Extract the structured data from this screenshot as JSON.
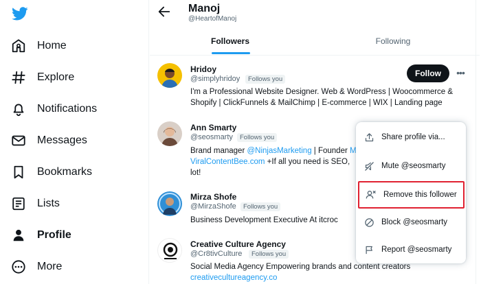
{
  "sidebar": {
    "items": [
      {
        "label": "Home",
        "icon": "home-icon"
      },
      {
        "label": "Explore",
        "icon": "hashtag-icon"
      },
      {
        "label": "Notifications",
        "icon": "bell-icon"
      },
      {
        "label": "Messages",
        "icon": "envelope-icon"
      },
      {
        "label": "Bookmarks",
        "icon": "bookmark-icon"
      },
      {
        "label": "Lists",
        "icon": "list-icon"
      },
      {
        "label": "Profile",
        "icon": "person-icon",
        "active": true
      },
      {
        "label": "More",
        "icon": "more-circle-icon"
      }
    ]
  },
  "header": {
    "name": "Manoj",
    "handle": "@HeartofManoj"
  },
  "tabs": [
    {
      "label": "Followers",
      "active": true
    },
    {
      "label": "Following",
      "active": false
    }
  ],
  "followers": [
    {
      "name": "Hridoy",
      "handle": "@simplyhridoy",
      "badge": "Follows you",
      "bio_lines": [
        "I'm a Professional Website Designer. Web & WordPress | Woocommerce &",
        "Shopify | ClickFunnels & MailChimp | E-commerce | WIX | Landing page"
      ],
      "button": "Follow"
    },
    {
      "name": "Ann Smarty",
      "handle": "@seosmarty",
      "badge": "Follows you",
      "bio_line1_prefix": "Brand manager ",
      "bio_line1_link": "@NinjasMarketing",
      "bio_line1_suffix": " | Founder ",
      "bio_line1_tail": "M",
      "bio_line2_link": "ViralContentBee.com",
      "bio_line2_suffix": " +If all you need is SEO,",
      "bio_line3": "lot!"
    },
    {
      "name": "Mirza Shofe",
      "handle": "@MirzaShofe",
      "badge": "Follows you",
      "bio_lines": [
        "Business Development Executive At itcroc"
      ]
    },
    {
      "name": "Creative Culture Agency",
      "handle": "@Cr8tivCulture",
      "badge": "Follows you",
      "bio_lines": [
        "Social Media Agency Empowering brands and content creators"
      ],
      "bio_link": "creativecultureagency.co"
    }
  ],
  "menu": {
    "items": [
      {
        "label": "Share profile via...",
        "icon": "share-icon"
      },
      {
        "label": "Mute @seosmarty",
        "icon": "mute-icon"
      },
      {
        "label": "Remove this follower",
        "icon": "remove-follower-icon",
        "highlighted": true
      },
      {
        "label": "Block @seosmarty",
        "icon": "block-icon"
      },
      {
        "label": "Report @seosmarty",
        "icon": "flag-icon"
      }
    ]
  },
  "colors": {
    "accent": "#1d9bf0",
    "highlight_border": "#e02030"
  }
}
